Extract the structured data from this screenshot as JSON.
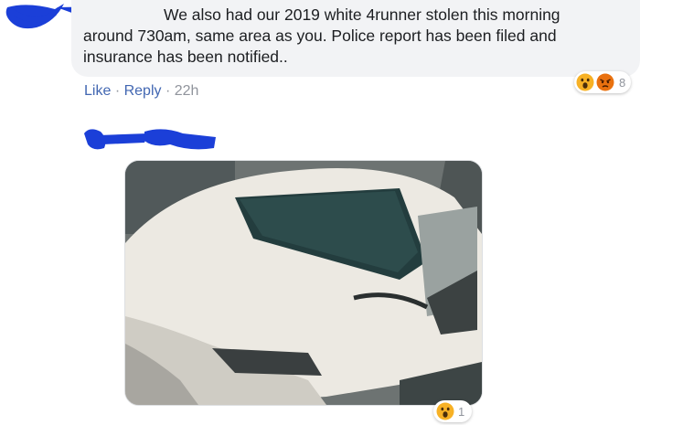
{
  "comment": {
    "text_line1": "We also had our 2019 white 4runner stolen this morning",
    "text_line2": "around 730am, same area as you. Police report has been filed and",
    "text_line3": "insurance has been notified..",
    "like_label": "Like",
    "separator": "·",
    "reply_label": "Reply",
    "timestamp": "22h",
    "reaction_count": "8",
    "reaction_icons": [
      "wow-icon",
      "angry-icon"
    ],
    "reaction_colors": {
      "wow": "#f7b125",
      "angry": "#e9710f"
    }
  },
  "reply": {
    "photo_description_icon": "photo-of-white-suv",
    "reaction_count": "1",
    "reaction_icons": [
      "wow-icon"
    ]
  },
  "colors": {
    "link": "#4267b2",
    "meta": "#90949c",
    "bubble": "#f2f3f5",
    "redaction": "#1b3fd8"
  }
}
